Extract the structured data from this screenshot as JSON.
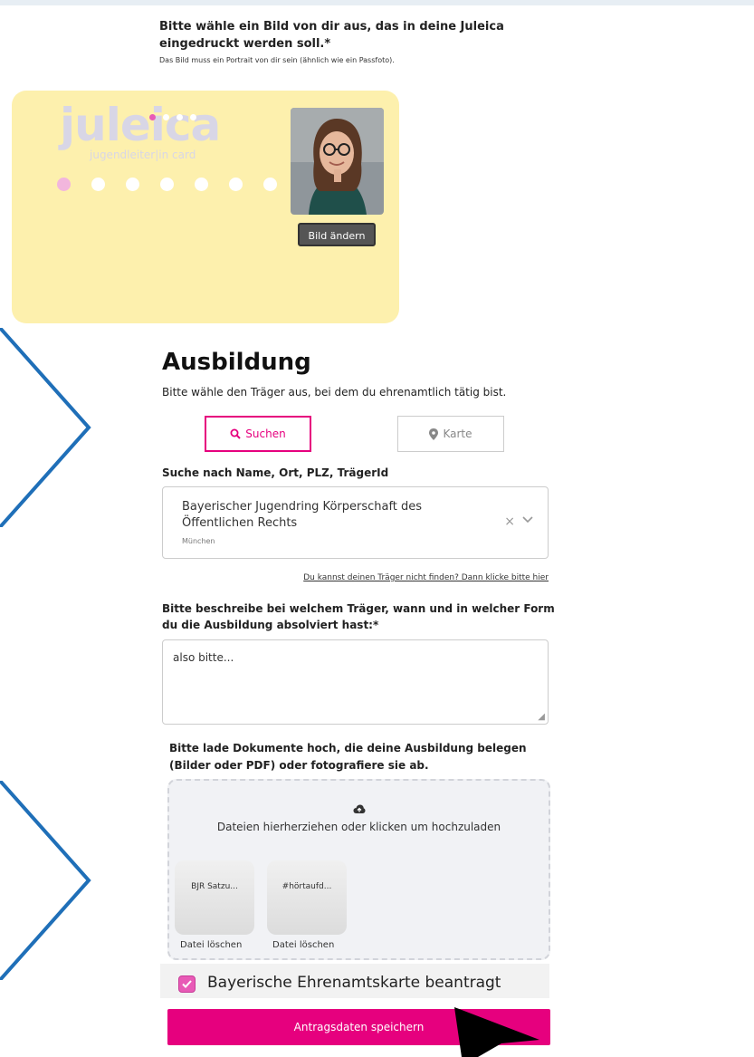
{
  "photo": {
    "label": "Bitte wähle ein Bild von dir aus, das in deine Juleica eingedruckt werden soll.*",
    "hint": "Das Bild muss ein Portrait von dir sein (ähnlich wie ein Passfoto).",
    "change_button": "Bild ändern"
  },
  "card": {
    "logo": "juleica",
    "logo_sub": "jugendleiter|in card",
    "background_color": "#fdf0ad"
  },
  "training": {
    "title": "Ausbildung",
    "description": "Bitte wähle den Träger aus, bei dem du ehrenamtlich tätig bist.",
    "tab_search": "Suchen",
    "tab_map": "Karte",
    "search_label": "Suche nach Name, Ort, PLZ, TrägerId",
    "selected_value": "Bayerischer Jugendring Körperschaft des Öffentlichen Rechts",
    "selected_city": "München",
    "not_found_link": "Du kannst deinen Träger nicht finden? Dann klicke bitte hier",
    "describe_label": "Bitte beschreibe bei welchem Träger, wann und in welcher Form du die Ausbildung absolviert hast:*",
    "describe_value": "also bitte..."
  },
  "upload": {
    "label": "Bitte lade Dokumente hoch, die deine Ausbildung belegen (Bilder oder PDF) oder fotografiere sie ab.",
    "dropzone_text": "Dateien hierherziehen oder klicken um hochzuladen",
    "files": [
      {
        "name": "BJR Satzu...",
        "delete_label": "Datei löschen"
      },
      {
        "name": "#hörtaufd...",
        "delete_label": "Datei löschen"
      }
    ]
  },
  "ehrenamt": {
    "label": "Bayerische Ehrenamtskarte beantragt",
    "checked": true
  },
  "submit": {
    "label": "Antragsdaten speichern"
  },
  "colors": {
    "accent": "#e6007e",
    "checkbox": "#e85ab6",
    "chevron": "#1f6fb8"
  }
}
